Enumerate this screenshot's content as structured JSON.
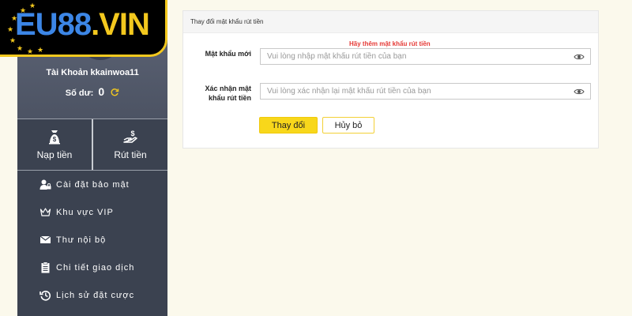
{
  "logo": {
    "text_blue": "EU88",
    "text_gold": ".VIN"
  },
  "profile": {
    "account_label": "Tài Khoản kkainwoa11",
    "balance_label": "Số dư:",
    "balance_value": "0"
  },
  "actions": {
    "deposit": "Nạp tiền",
    "withdraw": "Rút tiền"
  },
  "menu": [
    {
      "label": "Cài đặt bảo mật",
      "icon": "user-lock-icon"
    },
    {
      "label": "Khu vực VIP",
      "icon": "crown-icon"
    },
    {
      "label": "Thư nội bộ",
      "icon": "envelope-icon"
    },
    {
      "label": "Chi tiết giao dịch",
      "icon": "clipboard-icon"
    },
    {
      "label": "Lịch sử đặt cược",
      "icon": "history-icon"
    }
  ],
  "panel": {
    "title": "Thay đổi mật khẩu rút tiền",
    "hint": "Hãy thêm mật khẩu rút tiền",
    "new_password": {
      "label": "Mật khẩu mới",
      "placeholder": "Vui lòng nhập mật khẩu rút tiền của bạn",
      "value": ""
    },
    "confirm_password": {
      "label_line1": "Xác nhận mật",
      "label_line2": "khẩu rút tiền",
      "placeholder": "Vui lòng xác nhận lại mật khẩu rút tiền của bạn",
      "value": ""
    },
    "submit_label": "Thay đổi",
    "cancel_label": "Hủy bỏ"
  },
  "colors": {
    "page_bg": "#fbf9ec",
    "sidebar_bg": "#3b4250",
    "accent_yellow": "#f8d71b",
    "hint_red": "#e53935",
    "logo_blue": "#3c86e6",
    "logo_gold": "#f3c81e"
  }
}
